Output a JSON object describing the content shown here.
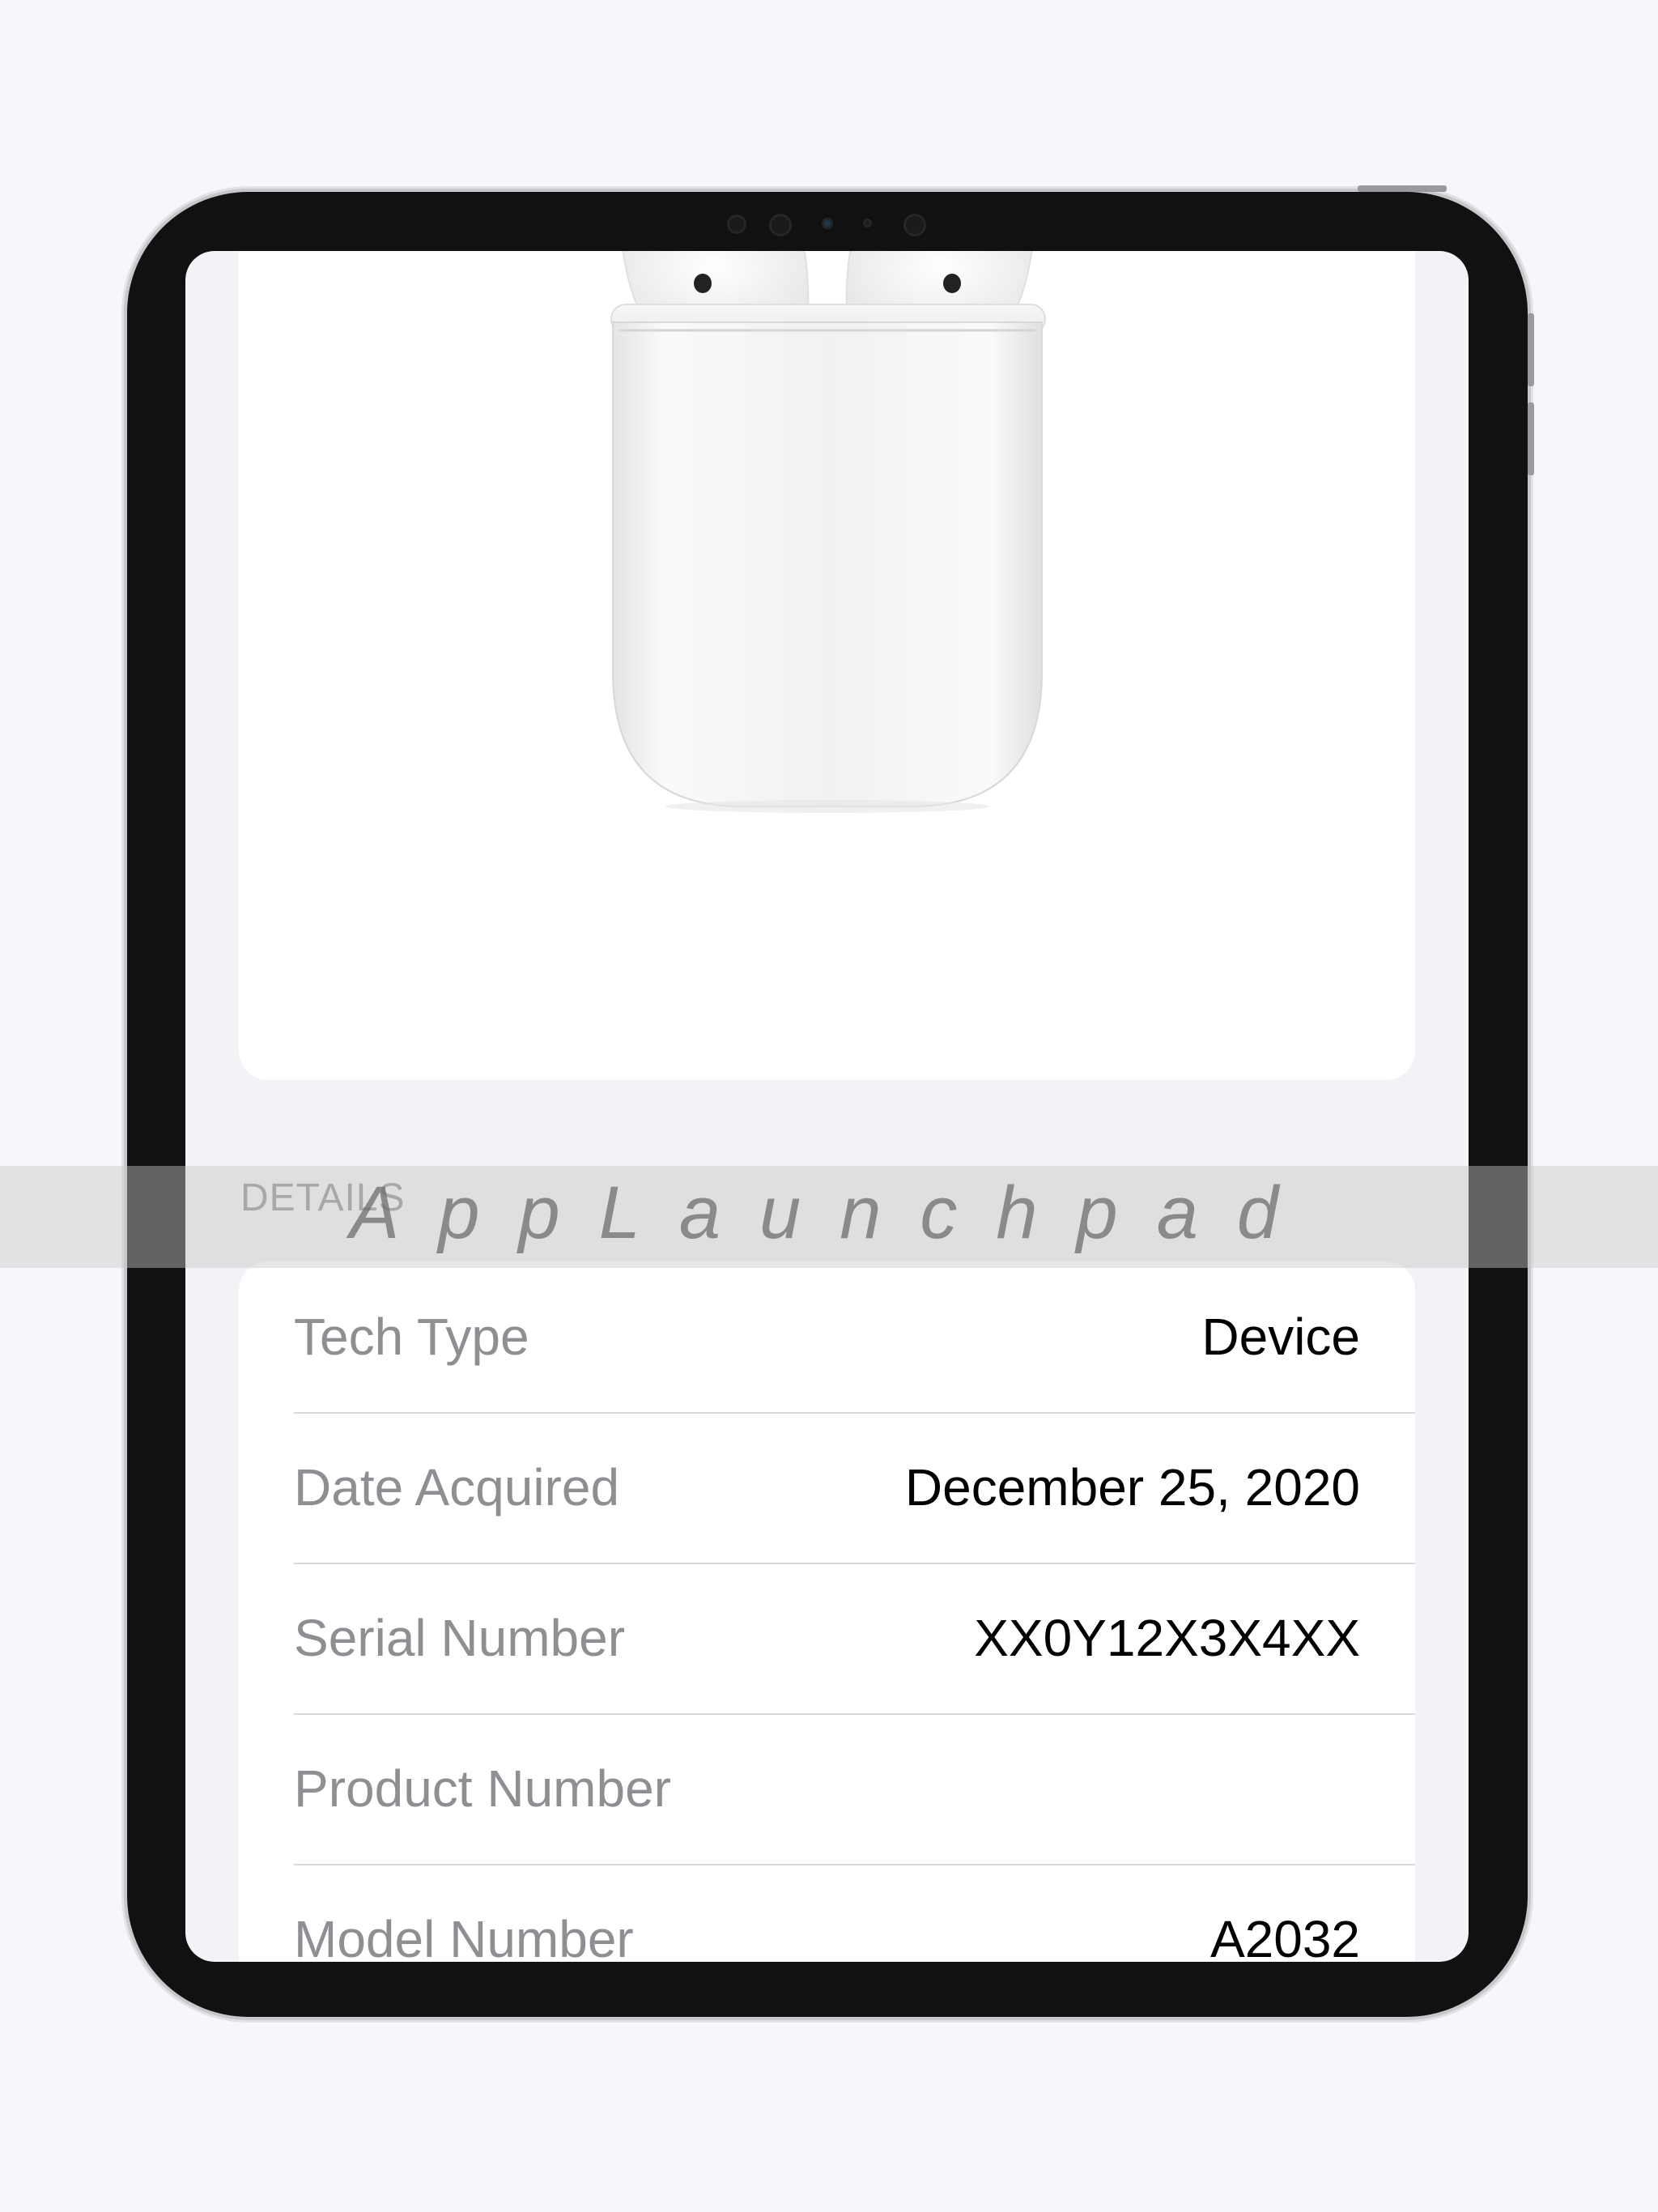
{
  "screen": {
    "product_image": "airpods-case-image",
    "section_header": "DETAILS",
    "details": [
      {
        "label": "Tech Type",
        "value": "Device"
      },
      {
        "label": "Date Acquired",
        "value": "December 25, 2020"
      },
      {
        "label": "Serial Number",
        "value": "XX0Y12X3X4XX"
      },
      {
        "label": "Product Number",
        "value": ""
      },
      {
        "label": "Model Number",
        "value": "A2032"
      }
    ]
  },
  "watermark": {
    "text": "AppLaunchpad"
  },
  "colors": {
    "page_background": "#f6f7fc",
    "screen_background": "#f2f2f7",
    "card_background": "#ffffff",
    "label_gray": "#8e8e93",
    "value_black": "#000000",
    "device_bezel": "#111111"
  }
}
